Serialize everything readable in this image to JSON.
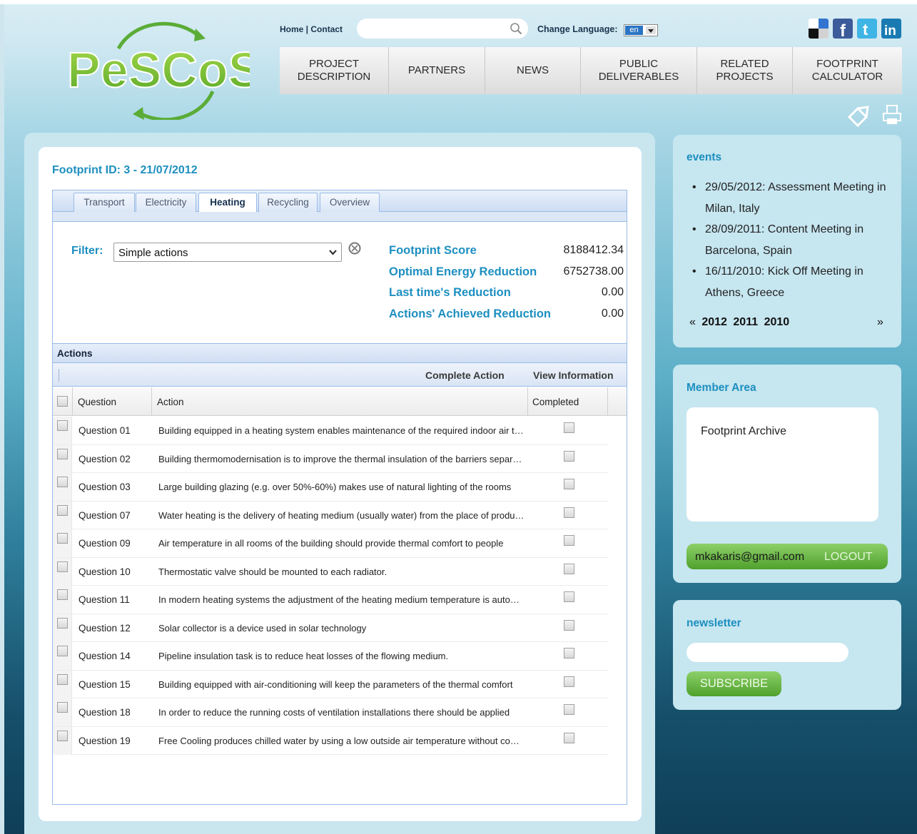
{
  "header": {
    "logo_text": "PeSCoS",
    "top_links": [
      "Home",
      "Contact"
    ],
    "search": {
      "placeholder": "",
      "value": ""
    },
    "language": {
      "label": "Change Language:",
      "value": "en"
    },
    "social": [
      "delicious-icon",
      "facebook-icon",
      "twitter-icon",
      "linkedin-icon"
    ],
    "nav": [
      "PROJECT\nDESCRIPTION",
      "PARTNERS",
      "NEWS",
      "PUBLIC\nDELIVERABLES",
      "RELATED\nPROJECTS",
      "FOOTPRINT\nCALCULATOR"
    ],
    "page_icons": [
      "share-icon",
      "print-icon"
    ]
  },
  "main": {
    "title": "Footprint ID: 3 - 21/07/2012",
    "tabs": [
      "Transport",
      "Electricity",
      "Heating",
      "Recycling",
      "Overview"
    ],
    "active_tab": "Heating",
    "filter": {
      "label": "Filter:",
      "value": "Simple actions"
    },
    "stats": [
      {
        "label": "Footprint Score",
        "value": "8188412.34"
      },
      {
        "label": "Optimal Energy Reduction",
        "value": "6752738.00"
      },
      {
        "label": "Last time's Reduction",
        "value": "0.00"
      },
      {
        "label": "Actions' Achieved Reduction",
        "value": "0.00"
      }
    ],
    "actions": {
      "title": "Actions",
      "toolbar": [
        "Complete Action",
        "View Information"
      ],
      "columns": [
        "Question",
        "Action",
        "Completed"
      ],
      "rows": [
        {
          "q": "Question 01",
          "a": "Building equipped in a heating system enables maintenance of the required indoor air temperature"
        },
        {
          "q": "Question 02",
          "a": "Building thermomodernisation is to improve the thermal insulation of the barriers separating"
        },
        {
          "q": "Question 03",
          "a": "Large building glazing (e.g. over 50%-60%) makes use of natural lighting of the rooms"
        },
        {
          "q": "Question 07",
          "a": "Water heating is the delivery of heating medium (usually water) from the place of production"
        },
        {
          "q": "Question 09",
          "a": "Air temperature in all rooms of the building should provide thermal comfort to people"
        },
        {
          "q": "Question 10",
          "a": "Thermostatic valve should be mounted to each radiator."
        },
        {
          "q": "Question 11",
          "a": "In modern heating systems the adjustment of the heating medium temperature is automatic"
        },
        {
          "q": "Question 12",
          "a": "Solar collector is a device used in solar technology"
        },
        {
          "q": "Question 14",
          "a": "Pipeline insulation task is to reduce heat losses of the flowing medium."
        },
        {
          "q": "Question 15",
          "a": "Building equipped with air-conditioning will keep the parameters of the thermal comfort"
        },
        {
          "q": "Question 18",
          "a": "In order to reduce the running costs of ventilation installations there should be applied"
        },
        {
          "q": "Question 19",
          "a": "Free Cooling produces chilled water by using a low outside air temperature without compressors"
        }
      ]
    }
  },
  "sidebar": {
    "events": {
      "title": "events",
      "items": [
        "29/05/2012: Assessment Meeting in Milan, Italy",
        "28/09/2011: Content Meeting in Barcelona, Spain",
        "16/11/2010: Kick Off Meeting in Athens, Greece"
      ],
      "prev": "«",
      "years": [
        "2012",
        "2011",
        "2010"
      ],
      "next": "»"
    },
    "member": {
      "title": "Member Area",
      "link": "Footprint Archive",
      "email": "mkakaris@gmail.com",
      "logout": "LOGOUT"
    },
    "newsletter": {
      "title": "newsletter",
      "placeholder": "",
      "button": "SUBSCRIBE"
    }
  },
  "colors": {
    "accent": "#1d8fc0",
    "green": "#5aac36",
    "grid_border": "#99bbe8"
  }
}
